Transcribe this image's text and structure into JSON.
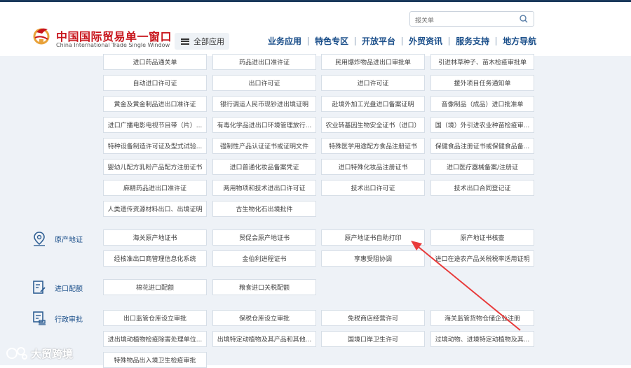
{
  "header": {
    "brand_cn": "中国国际贸易单一窗口",
    "brand_en": "China International Trade Single Window",
    "all_apps": "全部应用",
    "search_placeholder": "报关单",
    "nav": [
      "业务应用",
      "特色专区",
      "开放平台",
      "外贸资讯",
      "服务支持",
      "地方导航"
    ]
  },
  "license_grid": [
    [
      "进口药品通关单",
      "药品进出口准许证",
      "民用爆炸物品进出口审批单",
      "引进林草种子、苗木检疫审批单"
    ],
    [
      "自动进口许可证",
      "出口许可证",
      "进口许可证",
      "援外项目任务通知单"
    ],
    [
      "黄金及黄金制品进出口准许证",
      "银行调运人民币现钞进出境证明",
      "赴境外加工光盘进口备案证明",
      "音像制品（成品）进口批准单"
    ],
    [
      "进口广播电影电视节目带（片）...",
      "有毒化学品进出口环境管理放行...",
      "农业转基因生物安全证书（进口）",
      "国（境）外引进农业种苗检疫审..."
    ],
    [
      "特种设备制造许可证及型式试验...",
      "强制性产品认证证书或证明文件",
      "特殊医学用途配方食品注册证书",
      "保健食品注册证书或保健食品备..."
    ],
    [
      "婴幼儿配方乳粉产品配方注册证书",
      "进口普通化妆品备案凭证",
      "进口特殊化妆品注册证书",
      "进口医疗器械备案/注册证"
    ],
    [
      "麻精药品进出口准许证",
      "两用物项和技术进出口许可证",
      "技术出口许可证",
      "技术出口合同登记证"
    ],
    [
      "人类遗传资源材料出口、出境证明",
      "古生物化石出境批件"
    ]
  ],
  "sections": {
    "origin": {
      "label": "原产地证",
      "items": [
        [
          "海关原产地证书",
          "贸促会原产地证书",
          "原产地证书自助打印",
          "原产地证书核查"
        ],
        [
          "经核准出口商管理信息化系统",
          "金伯利进程证书",
          "享惠受阻协调",
          "进口在途农产品关税税率适用证明"
        ]
      ]
    },
    "quota": {
      "label": "进口配额",
      "items": [
        [
          "棉花进口配额",
          "粮食进口关税配额"
        ]
      ]
    },
    "admin": {
      "label": "行政审批",
      "items": [
        [
          "出口监管仓库设立审批",
          "保税仓库设立审批",
          "免税商店经营许可",
          "海关监管货物仓储企业注册"
        ],
        [
          "进出境动植物检疫除害处理单位...",
          "出境特定动植物及其产品和其他...",
          "国境口岸卫生许可",
          "过境动物、进境特定动植物及其..."
        ],
        [
          "特殊物品出入境卫生检疫审批"
        ]
      ]
    }
  },
  "watermark": "大贸跨境",
  "colors": {
    "brand_red": "#c8161d",
    "nav_blue": "#1b4f8a",
    "arrow_red": "#e83a3a",
    "content_bg": "#eef2f7"
  }
}
